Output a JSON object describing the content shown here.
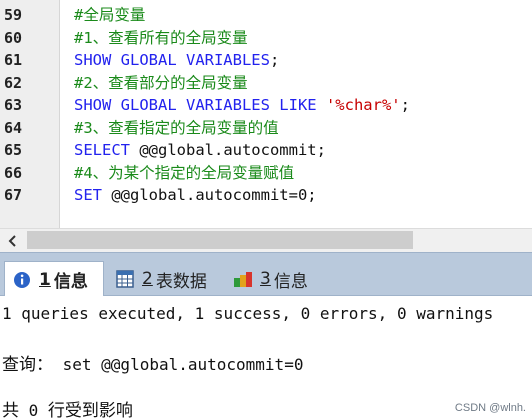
{
  "editor": {
    "lines": [
      {
        "num": "59",
        "segments": [
          {
            "text": "#全局变量",
            "kind": "comment"
          }
        ]
      },
      {
        "num": "60",
        "segments": [
          {
            "text": "#1、查看所有的全局变量",
            "kind": "comment"
          }
        ]
      },
      {
        "num": "61",
        "segments": [
          {
            "text": "SHOW GLOBAL VARIABLES",
            "kind": "kw"
          },
          {
            "text": ";",
            "kind": "plain"
          }
        ]
      },
      {
        "num": "62",
        "segments": [
          {
            "text": "#2、查看部分的全局变量",
            "kind": "comment"
          }
        ]
      },
      {
        "num": "63",
        "segments": [
          {
            "text": "SHOW GLOBAL VARIABLES LIKE ",
            "kind": "kw"
          },
          {
            "text": "'%char%'",
            "kind": "str"
          },
          {
            "text": ";",
            "kind": "plain"
          }
        ]
      },
      {
        "num": "64",
        "segments": [
          {
            "text": "#3、查看指定的全局变量的值",
            "kind": "comment"
          }
        ]
      },
      {
        "num": "65",
        "segments": [
          {
            "text": "SELECT ",
            "kind": "kw"
          },
          {
            "text": "@@global.autocommit;",
            "kind": "plain"
          }
        ]
      },
      {
        "num": "66",
        "segments": [
          {
            "text": "#4、为某个指定的全局变量赋值",
            "kind": "comment"
          }
        ]
      },
      {
        "num": "67",
        "segments": [
          {
            "text": "SET ",
            "kind": "kw"
          },
          {
            "text": "@@global.autocommit=0;",
            "kind": "plain"
          }
        ]
      }
    ]
  },
  "scrollbar": {
    "left_arrow": "chevron-left-icon"
  },
  "tabs": [
    {
      "num": "1",
      "label": "信息",
      "icon": "info-icon",
      "active": true
    },
    {
      "num": "2",
      "label": "表数据",
      "icon": "table-data-icon",
      "active": false
    },
    {
      "num": "3",
      "label": "信息",
      "icon": "messages-icon",
      "active": false
    }
  ],
  "output": {
    "line1": "1 queries executed, 1 success, 0 errors, 0 warnings",
    "line2_prefix": "查询：",
    "line2_query": " set @@global.autocommit=0",
    "line3_prefix": "共",
    "line3_count": " 0 ",
    "line3_suffix": "行受到影响"
  },
  "watermark": "CSDN @wlnh.",
  "colors": {
    "comment": "#1a8a1a",
    "keyword": "#2222ee",
    "string": "#c60000",
    "tabbar": "#b9c9dc"
  }
}
